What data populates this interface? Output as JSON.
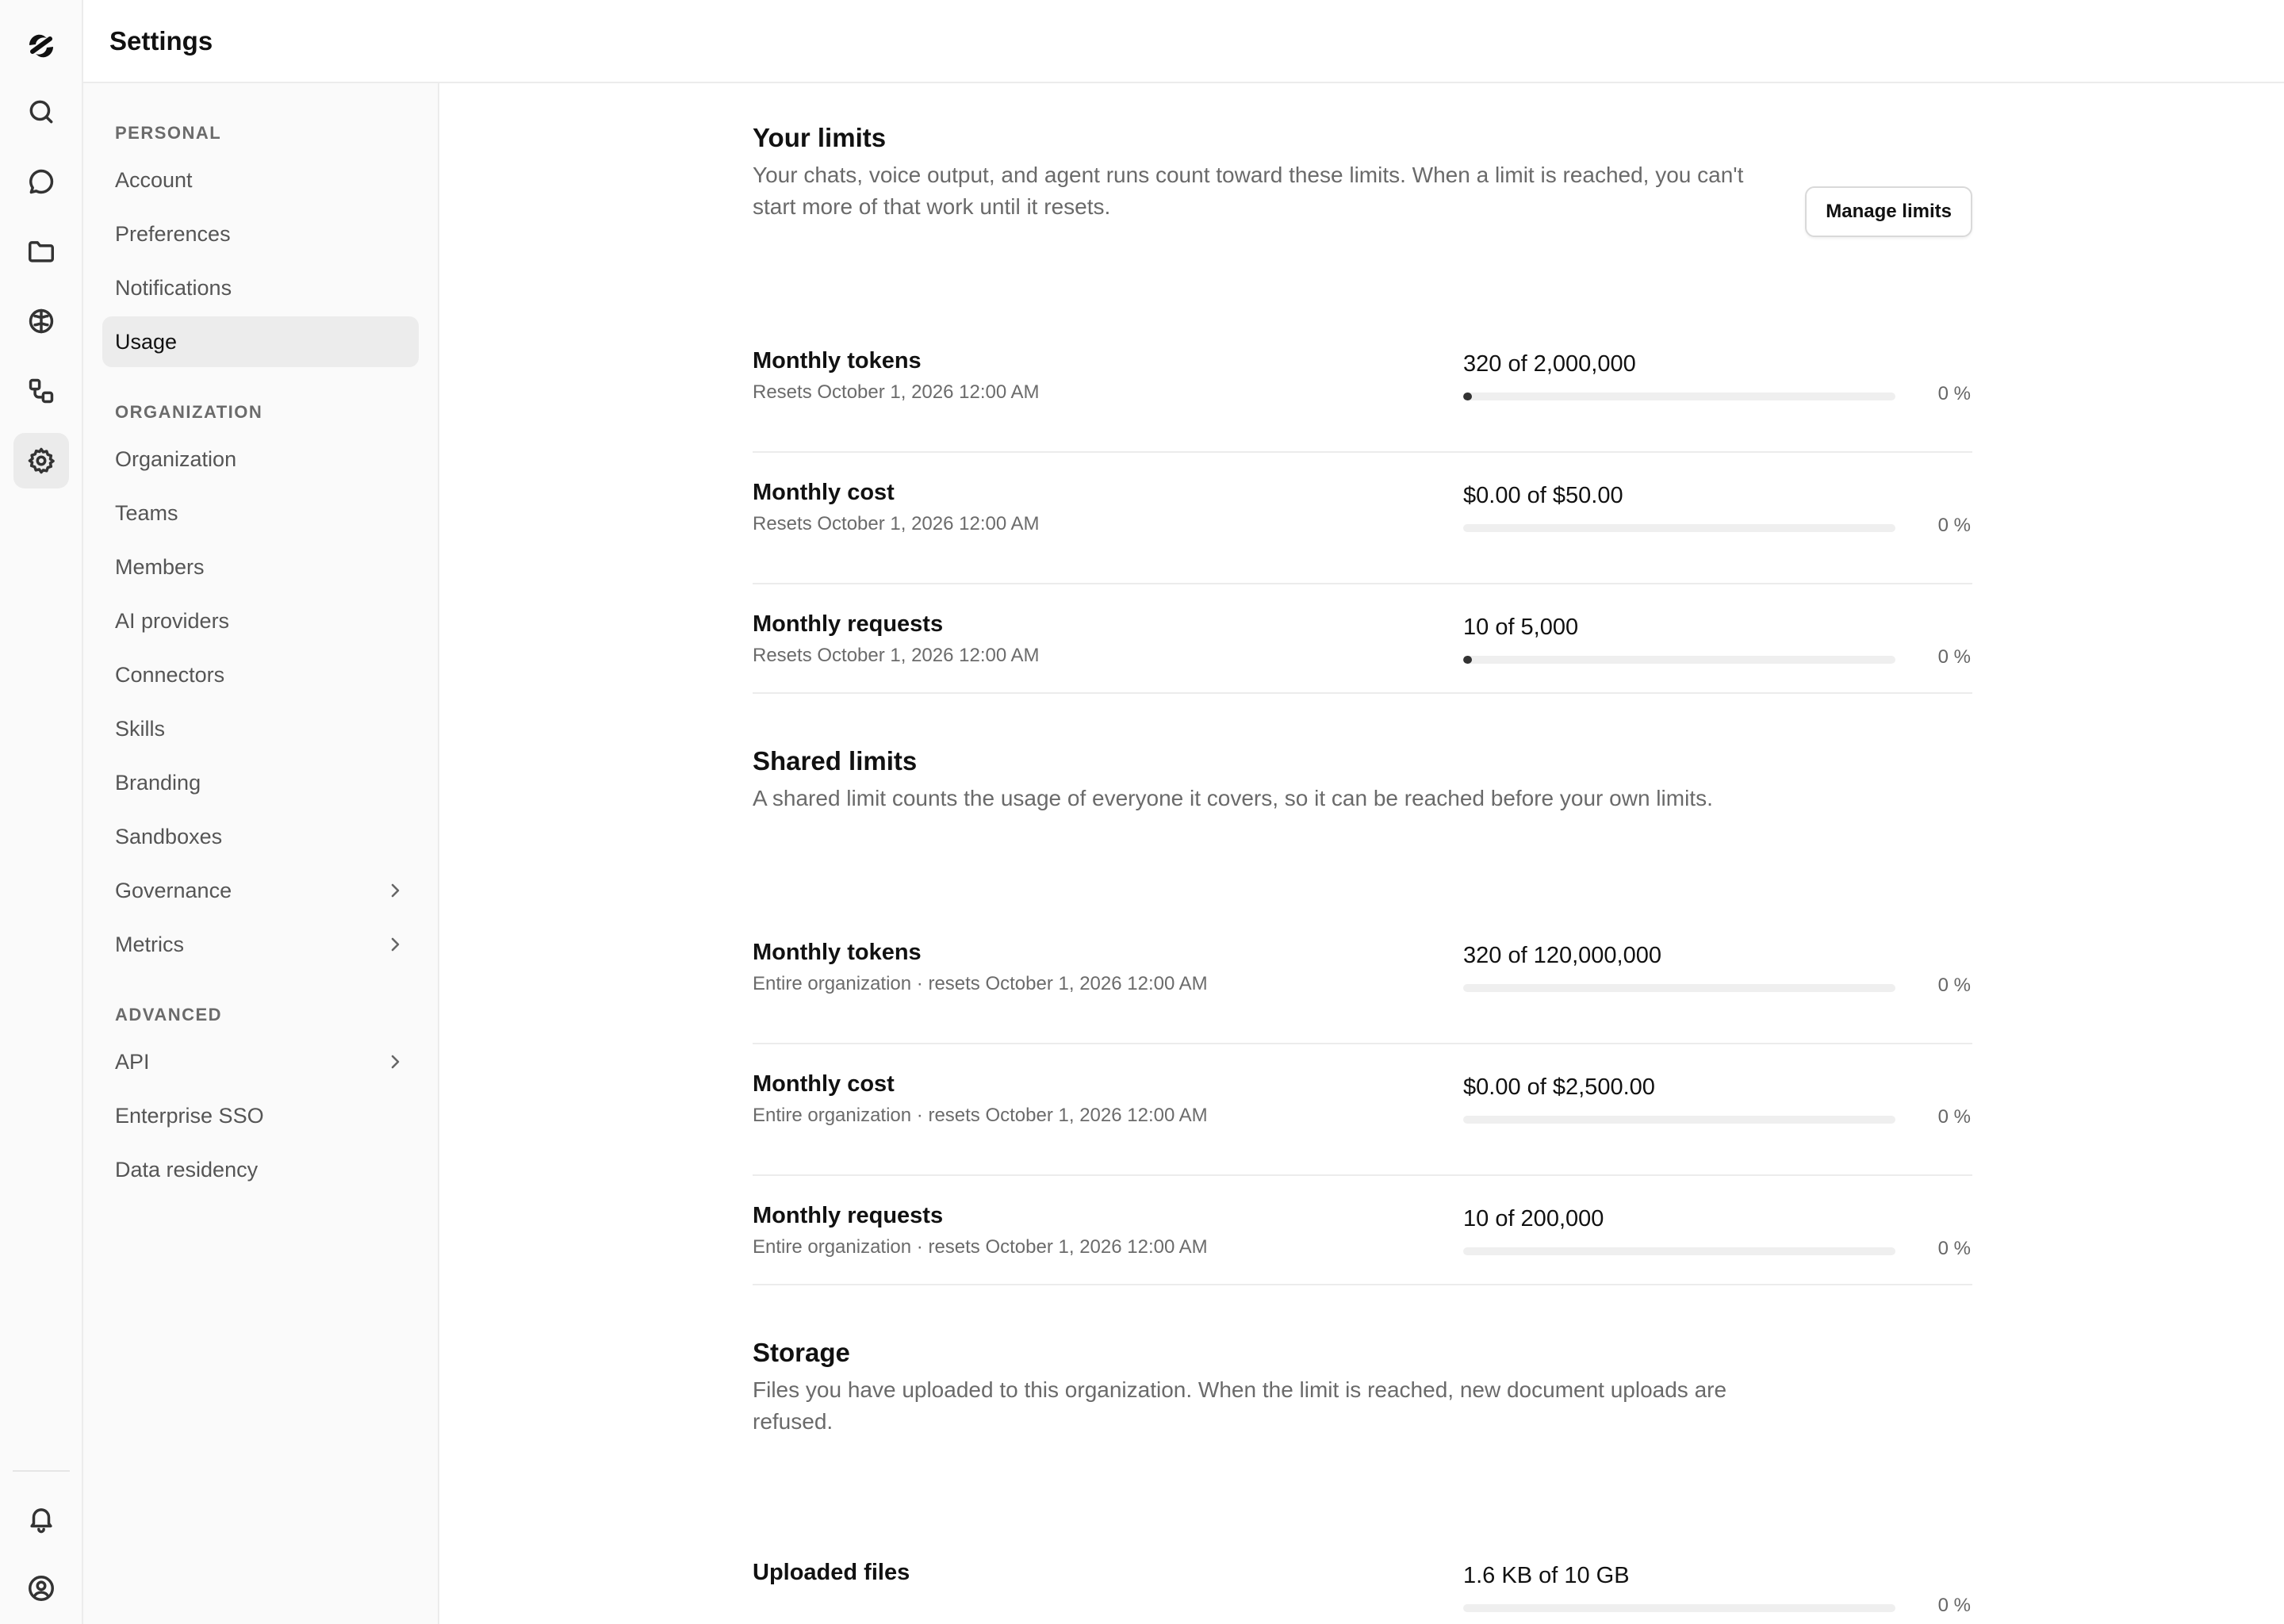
{
  "header": {
    "title": "Settings"
  },
  "rail": {
    "top": [
      {
        "icon": "search-icon",
        "active": false
      },
      {
        "icon": "chat-icon",
        "active": false
      },
      {
        "icon": "folder-icon",
        "active": false
      },
      {
        "icon": "brain-icon",
        "active": false
      },
      {
        "icon": "workflow-icon",
        "active": false
      },
      {
        "icon": "gear-icon",
        "active": true
      }
    ],
    "bottom": [
      {
        "icon": "bell-icon"
      },
      {
        "icon": "user-circle-icon"
      }
    ]
  },
  "nav": {
    "personal": {
      "title": "PERSONAL",
      "items": [
        {
          "label": "Account"
        },
        {
          "label": "Preferences"
        },
        {
          "label": "Notifications"
        },
        {
          "label": "Usage",
          "active": true
        }
      ]
    },
    "organization": {
      "title": "ORGANIZATION",
      "items": [
        {
          "label": "Organization"
        },
        {
          "label": "Teams"
        },
        {
          "label": "Members"
        },
        {
          "label": "AI providers"
        },
        {
          "label": "Connectors"
        },
        {
          "label": "Skills"
        },
        {
          "label": "Branding"
        },
        {
          "label": "Sandboxes"
        },
        {
          "label": "Governance",
          "chevron": true
        },
        {
          "label": "Metrics",
          "chevron": true
        }
      ]
    },
    "advanced": {
      "title": "ADVANCED",
      "items": [
        {
          "label": "API",
          "chevron": true
        },
        {
          "label": "Enterprise SSO"
        },
        {
          "label": "Data residency"
        }
      ]
    }
  },
  "your_limits": {
    "title": "Your limits",
    "description": "Your chats, voice output, and agent runs count toward these limits. When a limit is reached, you can't start more of that work until it resets.",
    "manage_label": "Manage limits",
    "rows": [
      {
        "label": "Monthly tokens",
        "sub": "Resets October 1, 2026 12:00 AM",
        "value": "320 of 2,000,000",
        "percent": "0 %",
        "fill": 0.00016
      },
      {
        "label": "Monthly cost",
        "sub": "Resets October 1, 2026 12:00 AM",
        "value": "$0.00 of $50.00",
        "percent": "0 %",
        "fill": 0
      },
      {
        "label": "Monthly requests",
        "sub": "Resets October 1, 2026 12:00 AM",
        "value": "10 of 5,000",
        "percent": "0 %",
        "fill": 0.002
      }
    ]
  },
  "shared_limits": {
    "title": "Shared limits",
    "description": "A shared limit counts the usage of everyone it covers, so it can be reached before your own limits.",
    "rows": [
      {
        "label": "Monthly tokens",
        "sub": "Entire organization · resets October 1, 2026 12:00 AM",
        "value": "320 of 120,000,000",
        "percent": "0 %",
        "fill": 0
      },
      {
        "label": "Monthly cost",
        "sub": "Entire organization · resets October 1, 2026 12:00 AM",
        "value": "$0.00 of $2,500.00",
        "percent": "0 %",
        "fill": 0
      },
      {
        "label": "Monthly requests",
        "sub": "Entire organization · resets October 1, 2026 12:00 AM",
        "value": "10 of 200,000",
        "percent": "0 %",
        "fill": 0
      }
    ]
  },
  "storage": {
    "title": "Storage",
    "description": "Files you have uploaded to this organization. When the limit is reached, new document uploads are refused.",
    "rows": [
      {
        "label": "Uploaded files",
        "sub": "",
        "value": "1.6 KB of 10 GB",
        "percent": "0 %",
        "fill": 0
      }
    ]
  }
}
